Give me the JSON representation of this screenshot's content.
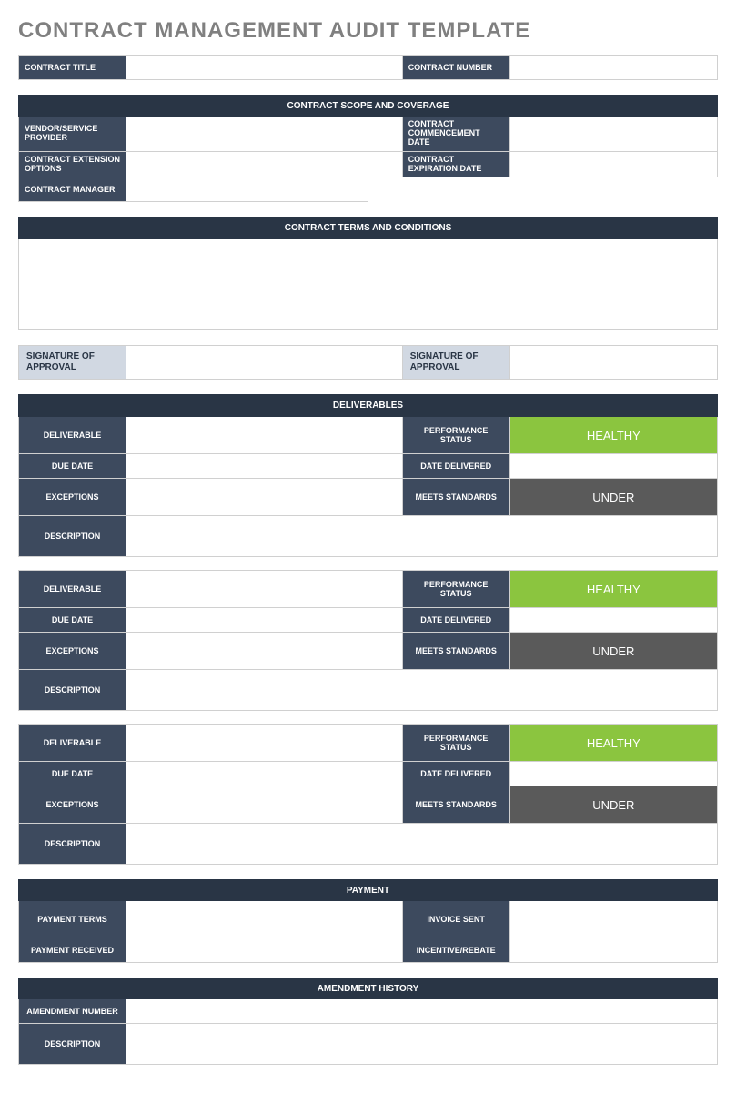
{
  "page_title": "CONTRACT MANAGEMENT AUDIT TEMPLATE",
  "top": {
    "contract_title_label": "CONTRACT TITLE",
    "contract_title_value": "",
    "contract_number_label": "CONTRACT NUMBER",
    "contract_number_value": ""
  },
  "scope": {
    "header": "CONTRACT SCOPE AND COVERAGE",
    "vendor_label": "VENDOR/SERVICE PROVIDER",
    "vendor_value": "",
    "commence_label": "CONTRACT COMMENCEMENT DATE",
    "commence_value": "",
    "ext_label": "CONTRACT EXTENSION OPTIONS",
    "ext_value": "",
    "exp_label": "CONTRACT EXPIRATION DATE",
    "exp_value": "",
    "mgr_label": "CONTRACT MANAGER",
    "mgr_value": ""
  },
  "terms": {
    "header": "CONTRACT TERMS AND CONDITIONS",
    "content": ""
  },
  "signatures": {
    "sig1_label": "SIGNATURE OF APPROVAL",
    "sig1_value": "",
    "sig2_label": "SIGNATURE OF APPROVAL",
    "sig2_value": ""
  },
  "deliverables": {
    "header": "DELIVERABLES",
    "labels": {
      "deliverable": "DELIVERABLE",
      "performance": "PERFORMANCE STATUS",
      "due": "DUE DATE",
      "delivered": "DATE DELIVERED",
      "exceptions": "EXCEPTIONS",
      "meets": "MEETS STANDARDS",
      "description": "DESCRIPTION"
    },
    "rows": [
      {
        "deliverable": "",
        "performance": "HEALTHY",
        "due": "",
        "delivered": "",
        "exceptions": "",
        "meets": "UNDER",
        "description": ""
      },
      {
        "deliverable": "",
        "performance": "HEALTHY",
        "due": "",
        "delivered": "",
        "exceptions": "",
        "meets": "UNDER",
        "description": ""
      },
      {
        "deliverable": "",
        "performance": "HEALTHY",
        "due": "",
        "delivered": "",
        "exceptions": "",
        "meets": "UNDER",
        "description": ""
      }
    ]
  },
  "payment": {
    "header": "PAYMENT",
    "terms_label": "PAYMENT TERMS",
    "terms_value": "",
    "invoice_label": "INVOICE SENT",
    "invoice_value": "",
    "received_label": "PAYMENT RECEIVED",
    "received_value": "",
    "incentive_label": "INCENTIVE/REBATE",
    "incentive_value": ""
  },
  "amendment": {
    "header": "AMENDMENT HISTORY",
    "num_label": "AMENDMENT NUMBER",
    "num_value": "",
    "desc_label": "DESCRIPTION",
    "desc_value": ""
  }
}
